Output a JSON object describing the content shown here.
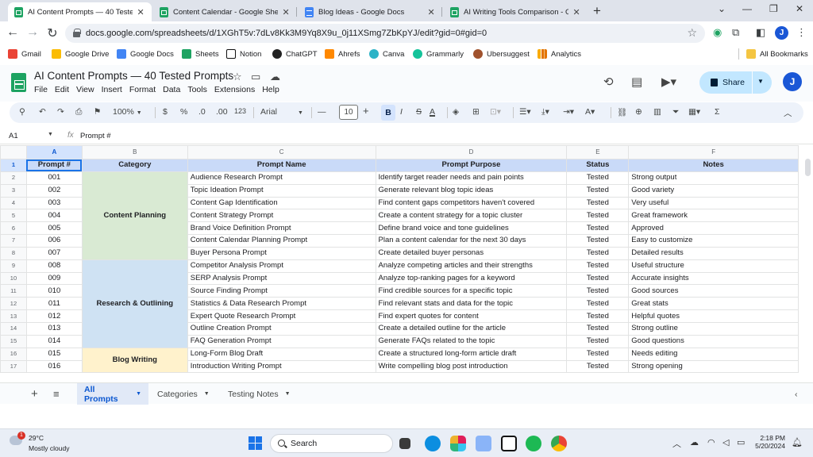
{
  "browser": {
    "tabs": [
      {
        "title": "AI Content Prompts — 40 Tested P",
        "icon": "sheets-icon",
        "active": true
      },
      {
        "title": "Content Calendar - Google Sheets",
        "icon": "sheets-icon",
        "active": false
      },
      {
        "title": "Blog Ideas - Google Docs",
        "icon": "docs-icon",
        "active": false
      },
      {
        "title": "AI Writing Tools Comparison - Goo",
        "icon": "sheets-icon",
        "active": false
      }
    ],
    "url": "docs.google.com/spreadsheets/d/1XGhT5v:7dLv8Kk3M9Yq8X9u_0j11XSmg7ZbKpYJ/edit?gid=0#gid=0",
    "profile_initial": "J",
    "bookmarks": [
      "Gmail",
      "Google Drive",
      "Google Docs",
      "Sheets",
      "Notion",
      "ChatGPT",
      "Ahrefs",
      "Canva",
      "Grammarly",
      "Ubersuggest",
      "Analytics"
    ],
    "all_bookmarks": "All Bookmarks"
  },
  "app": {
    "title": "AI Content Prompts — 40 Tested Prompts",
    "menus": [
      "File",
      "Edit",
      "View",
      "Insert",
      "Format",
      "Data",
      "Tools",
      "Extensions",
      "Help"
    ],
    "share_label": "Share",
    "avatar_initial": "J"
  },
  "toolbar": {
    "zoom": "100%",
    "currency": "$",
    "percent": "%",
    "dec_decrease": ".0",
    "dec_increase": ".00",
    "number_format": "123",
    "font": "Arial",
    "font_size": "10",
    "bold": "B"
  },
  "formula_bar": {
    "cell_ref": "A1",
    "content": "Prompt #"
  },
  "sheet": {
    "columns": [
      "A",
      "B",
      "C",
      "D",
      "E",
      "F"
    ],
    "headers": [
      "Prompt #",
      "Category",
      "Prompt Name",
      "Prompt Purpose",
      "Status",
      "Notes"
    ],
    "categories": [
      {
        "label": "Content Planning",
        "color": "#d9ead3"
      },
      {
        "label": "Research & Outlining",
        "color": "#cfe2f3"
      },
      {
        "label": "Blog Writing",
        "color": "#fff2cc"
      }
    ],
    "rows": [
      {
        "row": "2",
        "num": "001",
        "name": "Audience Research Prompt",
        "purpose": "Identify target reader needs and pain points",
        "status": "Tested",
        "notes": "Strong output"
      },
      {
        "row": "3",
        "num": "002",
        "name": "Topic Ideation Prompt",
        "purpose": "Generate relevant blog topic ideas",
        "status": "Tested",
        "notes": "Good variety"
      },
      {
        "row": "4",
        "num": "003",
        "name": "Content Gap Identification",
        "purpose": "Find content gaps competitors haven't covered",
        "status": "Tested",
        "notes": "Very useful"
      },
      {
        "row": "5",
        "num": "004",
        "name": "Content Strategy Prompt",
        "purpose": "Create a content strategy for a topic cluster",
        "status": "Tested",
        "notes": "Great framework"
      },
      {
        "row": "6",
        "num": "005",
        "name": "Brand Voice Definition Prompt",
        "purpose": "Define brand voice and tone guidelines",
        "status": "Tested",
        "notes": "Approved"
      },
      {
        "row": "7",
        "num": "006",
        "name": "Content Calendar Planning Prompt",
        "purpose": "Plan a content calendar for the next 30 days",
        "status": "Tested",
        "notes": "Easy to customize"
      },
      {
        "row": "8",
        "num": "007",
        "name": "Buyer Persona Prompt",
        "purpose": "Create detailed buyer personas",
        "status": "Tested",
        "notes": "Detailed results"
      },
      {
        "row": "9",
        "num": "008",
        "name": "Competitor Analysis Prompt",
        "purpose": "Analyze competing articles and their strengths",
        "status": "Tested",
        "notes": "Useful structure"
      },
      {
        "row": "10",
        "num": "009",
        "name": "SERP Analysis Prompt",
        "purpose": "Analyze top-ranking pages for a keyword",
        "status": "Tested",
        "notes": "Accurate insights"
      },
      {
        "row": "11",
        "num": "010",
        "name": "Source Finding Prompt",
        "purpose": "Find credible sources for a specific topic",
        "status": "Tested",
        "notes": "Good sources"
      },
      {
        "row": "12",
        "num": "011",
        "name": "Statistics & Data Research Prompt",
        "purpose": "Find relevant stats and data for the topic",
        "status": "Tested",
        "notes": "Great stats"
      },
      {
        "row": "13",
        "num": "012",
        "name": "Expert Quote Research Prompt",
        "purpose": "Find expert quotes for content",
        "status": "Tested",
        "notes": "Helpful quotes"
      },
      {
        "row": "14",
        "num": "013",
        "name": "Outline Creation Prompt",
        "purpose": "Create a detailed outline for the article",
        "status": "Tested",
        "notes": "Strong outline"
      },
      {
        "row": "15",
        "num": "014",
        "name": "FAQ Generation Prompt",
        "purpose": "Generate FAQs related to the topic",
        "status": "Tested",
        "notes": "Good questions"
      },
      {
        "row": "16",
        "num": "015",
        "name": "Long-Form Blog Draft",
        "purpose": "Create a structured long-form article draft",
        "status": "Tested",
        "notes": "Needs editing"
      },
      {
        "row": "17",
        "num": "016",
        "name": "Introduction Writing Prompt",
        "purpose": "Write compelling blog post introduction",
        "status": "Tested",
        "notes": "Strong opening"
      }
    ]
  },
  "sheet_tabs": [
    "All Prompts",
    "Categories",
    "Testing Notes"
  ],
  "taskbar": {
    "temperature": "29°C",
    "weather": "Mostly cloudy",
    "weather_badge": "1",
    "search_label": "Search",
    "time": "2:18 PM",
    "date": "5/20/2024"
  }
}
